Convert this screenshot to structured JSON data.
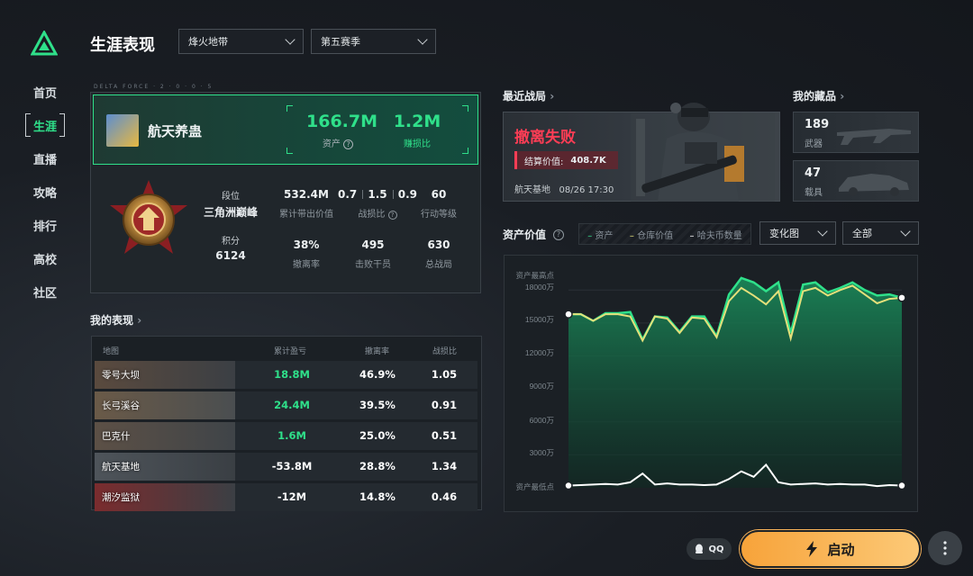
{
  "header": {
    "title": "生涯表现",
    "mode_select": "烽火地带",
    "season_select": "第五赛季"
  },
  "sidebar": {
    "items": [
      {
        "label": "首页"
      },
      {
        "label": "生涯",
        "active": true
      },
      {
        "label": "直播"
      },
      {
        "label": "攻略"
      },
      {
        "label": "排行"
      },
      {
        "label": "高校"
      },
      {
        "label": "社区"
      }
    ]
  },
  "profile": {
    "tag": "DELTA FORCE · 2 · 0 · 0 · 5",
    "username": "航天养蛊",
    "assets_value": "166.7M",
    "assets_label": "资产",
    "kd_value": "1.2M",
    "kd_label": "赚损比",
    "rank_label": "段位",
    "rank_name": "三角洲巅峰",
    "score_label": "积分",
    "score_value": "6124",
    "stats": {
      "cumulative_value": "532.4M",
      "cumulative_label": "累计带出价值",
      "kd_values": [
        "0.7",
        "1.5",
        "0.9"
      ],
      "kd_label": "战损比",
      "action_level": "60",
      "action_level_label": "行动等级",
      "evac_rate": "38%",
      "evac_label": "撤离率",
      "kills": "495",
      "kills_label": "击败干员",
      "total_matches": "630",
      "total_label": "总战局"
    }
  },
  "performance": {
    "title": "我的表现",
    "columns": [
      "地图",
      "累计盈亏",
      "撤离率",
      "战损比"
    ],
    "rows": [
      {
        "map": "零号大坝",
        "pnl": "18.8M",
        "evac": "46.9%",
        "kd": "1.05",
        "positive": true
      },
      {
        "map": "长弓溪谷",
        "pnl": "24.4M",
        "evac": "39.5%",
        "kd": "0.91",
        "positive": true
      },
      {
        "map": "巴克什",
        "pnl": "1.6M",
        "evac": "25.0%",
        "kd": "0.51",
        "positive": true
      },
      {
        "map": "航天基地",
        "pnl": "-53.8M",
        "evac": "28.8%",
        "kd": "1.34",
        "positive": false
      },
      {
        "map": "潮汐监狱",
        "pnl": "-12M",
        "evac": "14.8%",
        "kd": "0.46",
        "positive": false
      }
    ]
  },
  "recent_battle": {
    "title": "最近战局",
    "result": "撤离失败",
    "settle_label": "结算价值:",
    "settle_value": "408.7K",
    "map": "航天基地",
    "time": "08/26 17:30"
  },
  "collection": {
    "title": "我的藏品",
    "items": [
      {
        "count": "189",
        "label": "武器"
      },
      {
        "count": "47",
        "label": "载具"
      }
    ]
  },
  "asset_chart": {
    "title": "资产价值",
    "legend": [
      "资产",
      "仓库价值",
      "哈夫币数量"
    ],
    "view_select": "变化图",
    "range_select": "全部",
    "colors": {
      "asset": "#2fe08a",
      "warehouse": "#e4e07a",
      "havc": "#ffffff"
    }
  },
  "chart_data": {
    "type": "line",
    "ytick_labels": [
      "资产最高点",
      "18000万",
      "15000万",
      "12000万",
      "9000万",
      "6000万",
      "3000万",
      "资产最低点"
    ],
    "yticks": [
      18000,
      15000,
      12000,
      9000,
      6000,
      3000
    ],
    "ylim": [
      0,
      19500
    ],
    "grid": true,
    "series": [
      {
        "name": "资产",
        "values": [
          15800,
          15800,
          15200,
          15900,
          15900,
          16000,
          13500,
          15600,
          15500,
          14200,
          15600,
          15600,
          13800,
          17600,
          19100,
          18700,
          17900,
          18700,
          14100,
          18500,
          18700,
          17800,
          18200,
          18700,
          18000,
          17500,
          17600,
          17300
        ]
      },
      {
        "name": "仓库价值",
        "values": [
          15800,
          15800,
          15200,
          15800,
          15800,
          15600,
          13400,
          15600,
          15400,
          14100,
          15500,
          15400,
          13700,
          17000,
          18200,
          17500,
          16700,
          17900,
          13600,
          17900,
          18200,
          17500,
          18000,
          18400,
          17600,
          16800,
          17200,
          17300
        ]
      },
      {
        "name": "哈夫币数量",
        "values": [
          200,
          250,
          300,
          350,
          300,
          500,
          1300,
          300,
          400,
          300,
          300,
          250,
          300,
          800,
          1500,
          1000,
          2100,
          500,
          300,
          350,
          400,
          300,
          350,
          300,
          300,
          150,
          250,
          200
        ]
      }
    ]
  },
  "footer": {
    "qq_label": "QQ",
    "launch_label": "启动"
  }
}
